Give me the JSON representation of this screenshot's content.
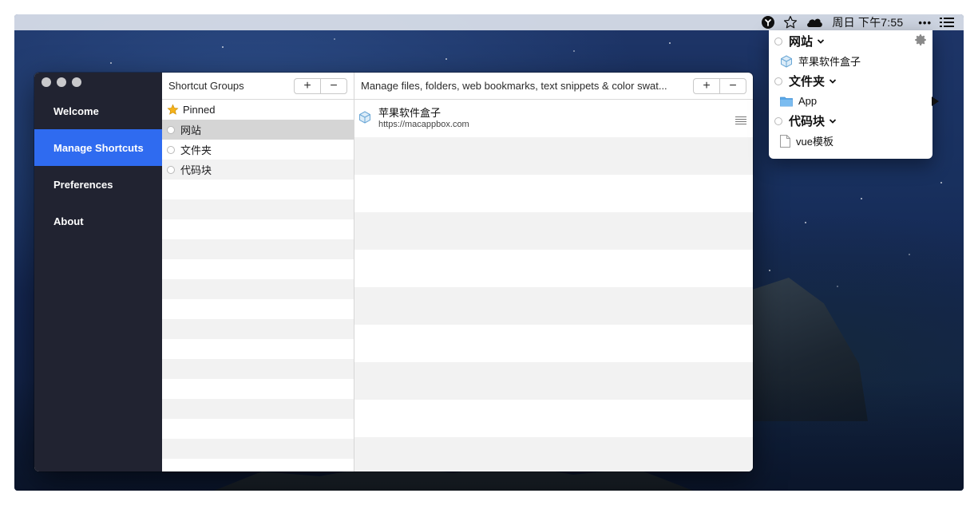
{
  "menubar": {
    "clock": "周日 下午7:55",
    "more": "•••",
    "icons": [
      "app-status-icon",
      "star-icon",
      "cloud-icon",
      "list-icon"
    ]
  },
  "app": {
    "nav": [
      {
        "label": "Welcome",
        "active": false
      },
      {
        "label": "Manage Shortcuts",
        "active": true
      },
      {
        "label": "Preferences",
        "active": false
      },
      {
        "label": "About",
        "active": false
      }
    ],
    "groups_panel": {
      "title": "Shortcut Groups",
      "add_label": "+",
      "remove_label": "−",
      "items": [
        {
          "label": "Pinned",
          "icon": "star-icon"
        },
        {
          "label": "网站",
          "icon": "radio-icon",
          "selected": true
        },
        {
          "label": "文件夹",
          "icon": "radio-icon"
        },
        {
          "label": "代码块",
          "icon": "radio-icon"
        }
      ]
    },
    "content_panel": {
      "title": "Manage files, folders, web bookmarks, text snippets & color swat...",
      "add_label": "+",
      "remove_label": "−",
      "items": [
        {
          "title": "苹果软件盒子",
          "url": "https://macappbox.com",
          "icon": "cube-icon"
        }
      ]
    }
  },
  "dropdown": {
    "sections": [
      {
        "header": "网站",
        "items": [
          {
            "label": "苹果软件盒子",
            "icon": "cube-icon"
          }
        ]
      },
      {
        "header": "文件夹",
        "items": [
          {
            "label": "App",
            "icon": "folder-icon",
            "has_submenu": true
          }
        ]
      },
      {
        "header": "代码块",
        "items": [
          {
            "label": "vue模板",
            "icon": "document-icon"
          }
        ]
      }
    ],
    "settings_icon": "gear-icon"
  },
  "colors": {
    "sidebar": "#212331",
    "accent": "#2f6bf0",
    "folder": "#5aa8e8"
  }
}
